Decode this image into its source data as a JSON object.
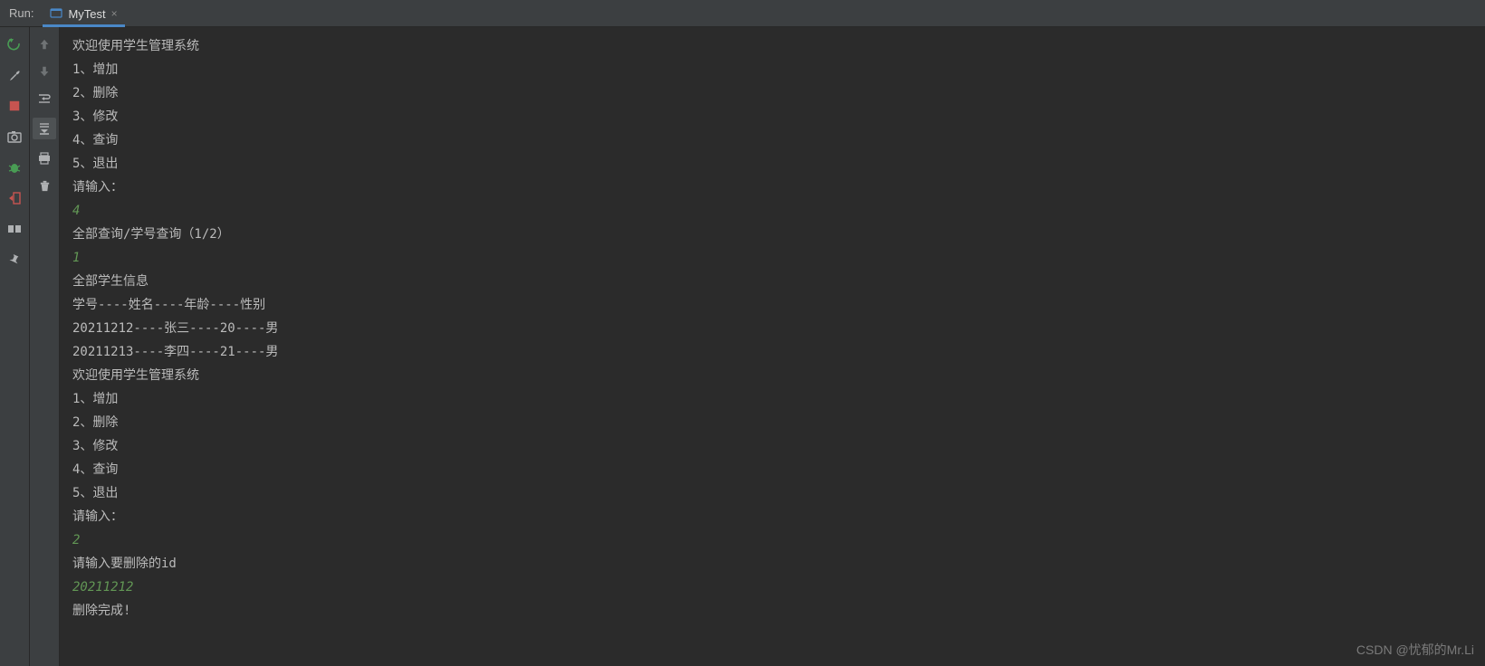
{
  "header": {
    "run_label": "Run:",
    "tab_name": "MyTest"
  },
  "console": {
    "lines": [
      {
        "text": "欢迎使用学生管理系统",
        "type": "out"
      },
      {
        "text": "1、增加",
        "type": "out"
      },
      {
        "text": "2、删除",
        "type": "out"
      },
      {
        "text": "3、修改",
        "type": "out"
      },
      {
        "text": "4、查询",
        "type": "out"
      },
      {
        "text": "5、退出",
        "type": "out"
      },
      {
        "text": "请输入：",
        "type": "out"
      },
      {
        "text": "4",
        "type": "in"
      },
      {
        "text": "全部查询/学号查询（1/2）",
        "type": "out"
      },
      {
        "text": "1",
        "type": "in"
      },
      {
        "text": "全部学生信息",
        "type": "out"
      },
      {
        "text": "学号----姓名----年龄----性别",
        "type": "out"
      },
      {
        "text": "20211212----张三----20----男",
        "type": "out"
      },
      {
        "text": "20211213----李四----21----男",
        "type": "out"
      },
      {
        "text": "欢迎使用学生管理系统",
        "type": "out"
      },
      {
        "text": "1、增加",
        "type": "out"
      },
      {
        "text": "2、删除",
        "type": "out"
      },
      {
        "text": "3、修改",
        "type": "out"
      },
      {
        "text": "4、查询",
        "type": "out"
      },
      {
        "text": "5、退出",
        "type": "out"
      },
      {
        "text": "请输入：",
        "type": "out"
      },
      {
        "text": "2",
        "type": "in"
      },
      {
        "text": "请输入要删除的id",
        "type": "out"
      },
      {
        "text": "20211212",
        "type": "in"
      },
      {
        "text": "删除完成!",
        "type": "out"
      }
    ]
  },
  "watermark": "CSDN @忧郁的Mr.Li"
}
